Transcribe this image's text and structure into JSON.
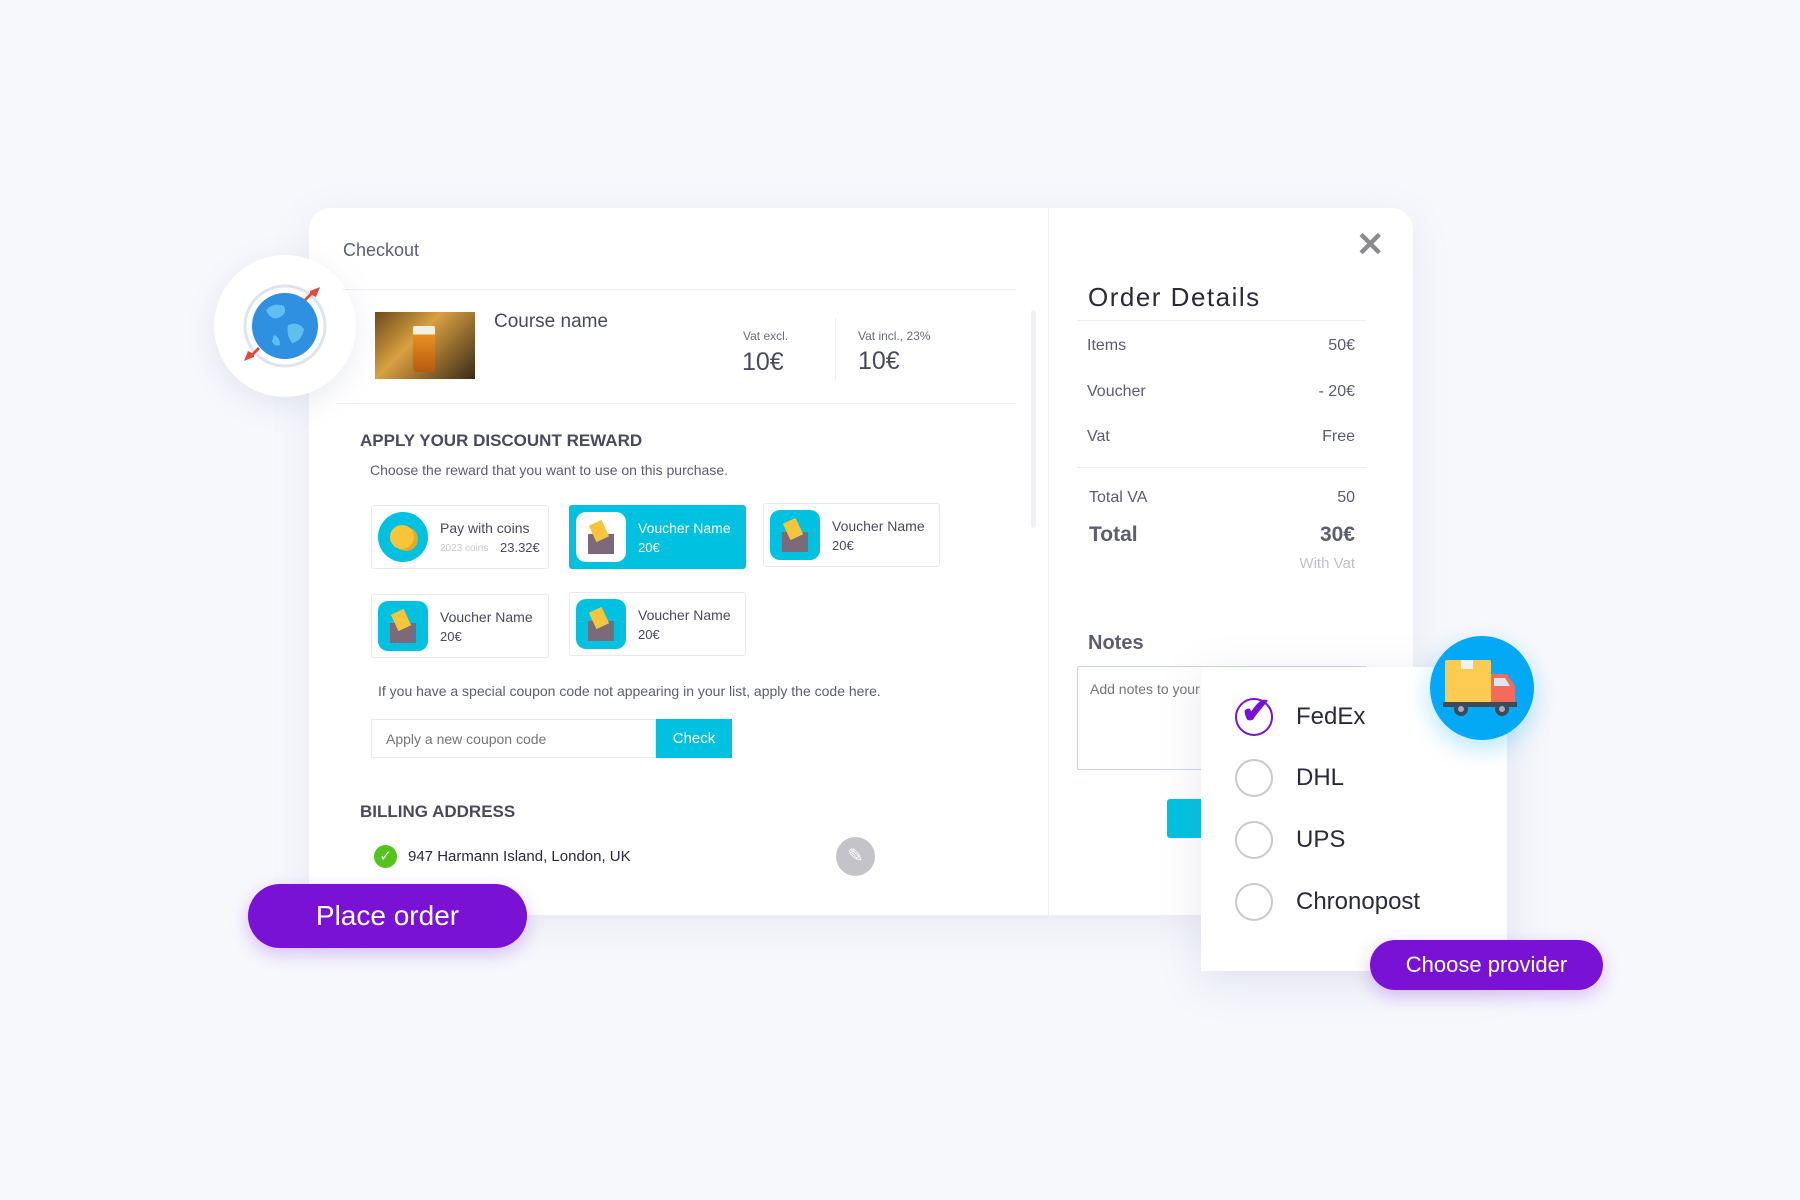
{
  "checkout": {
    "title": "Checkout",
    "course": {
      "name": "Course name",
      "vat_excl_label": "Vat excl.",
      "vat_excl_value": "10€",
      "vat_incl_label": "Vat incl., 23%",
      "vat_incl_value": "10€"
    },
    "discount": {
      "heading": "APPLY YOUR DISCOUNT REWARD",
      "subtitle": "Choose the reward that you want to use on this purchase.",
      "coins": {
        "label": "Pay with coins",
        "coins": "2023 coins",
        "value": "23.32€"
      },
      "vouchers": [
        {
          "name": "Voucher Name",
          "value": "20€",
          "selected": true
        },
        {
          "name": "Voucher Name",
          "value": "20€",
          "selected": false
        },
        {
          "name": "Voucher Name",
          "value": "20€",
          "selected": false
        },
        {
          "name": "Voucher Name",
          "value": "20€",
          "selected": false
        }
      ],
      "coupon_hint": "If you have a special coupon code not appearing in your list, apply the code here.",
      "coupon_placeholder": "Apply a new coupon code",
      "check_label": "Check"
    },
    "billing": {
      "heading": "BILLING ADDRESS",
      "address": "947 Harmann Island, London, UK"
    },
    "place_order": "Place order"
  },
  "order_details": {
    "title": "Order Details",
    "rows": [
      {
        "label": "Items",
        "value": "50€"
      },
      {
        "label": "Voucher",
        "value": "- 20€"
      },
      {
        "label": "Vat",
        "value": "Free"
      }
    ],
    "total_va_label": "Total VA",
    "total_va_value": "50",
    "total_label": "Total",
    "total_value": "30€",
    "with_vat": "With Vat",
    "notes_label": "Notes",
    "notes_placeholder": "Add notes to your order"
  },
  "shipping": {
    "providers": [
      {
        "name": "FedEx",
        "selected": true
      },
      {
        "name": "DHL",
        "selected": false
      },
      {
        "name": "UPS",
        "selected": false
      },
      {
        "name": "Chronopost",
        "selected": false
      }
    ],
    "choose_label": "Choose provider"
  },
  "colors": {
    "accent": "#7a12d6",
    "cyan": "#00c2e0",
    "success": "#52c41a",
    "truck_bg": "#03a9f4"
  }
}
